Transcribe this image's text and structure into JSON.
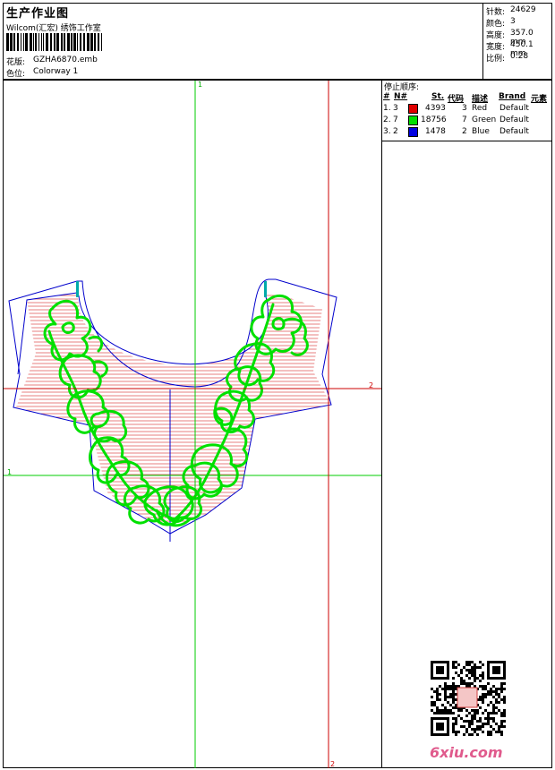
{
  "header": {
    "title": "生产作业图",
    "software": "Wilcom(汇宏) 绣饰工作室",
    "design_label": "花版:",
    "design_value": "GZHA6870.emb",
    "colorway_label": "色位:",
    "colorway_value": "Colorway 1"
  },
  "stats": [
    {
      "label": "针数:",
      "value": "24629"
    },
    {
      "label": "颜色:",
      "value": "3"
    },
    {
      "label": "高度:",
      "value": "357.0 mm"
    },
    {
      "label": "宽度:",
      "value": "450.1 mm"
    },
    {
      "label": "比例:",
      "value": "0.28"
    }
  ],
  "stop_sequence": {
    "title": "停止顺序:",
    "headers": [
      "#",
      "N#",
      "St.",
      "代码",
      "描述",
      "Brand",
      "元素"
    ],
    "rows": [
      {
        "idx": "1.",
        "n": "3",
        "color": "#e00000",
        "st": "4393",
        "code": "3",
        "desc": "Red",
        "brand": "Default"
      },
      {
        "idx": "2.",
        "n": "7",
        "color": "#00e000",
        "st": "18756",
        "code": "7",
        "desc": "Green",
        "brand": "Default"
      },
      {
        "idx": "3.",
        "n": "2",
        "color": "#0000e0",
        "st": "1478",
        "code": "2",
        "desc": "Blue",
        "brand": "Default"
      }
    ]
  },
  "guides": {
    "v1": "1",
    "h1": "1",
    "h2": "2",
    "v2": "2"
  },
  "colors": {
    "red": "#d00000",
    "green": "#00e000",
    "blue": "#0000cc",
    "guide_green": "#00cc00",
    "guide_red": "#cc0000"
  },
  "watermark": "6xiu.com"
}
